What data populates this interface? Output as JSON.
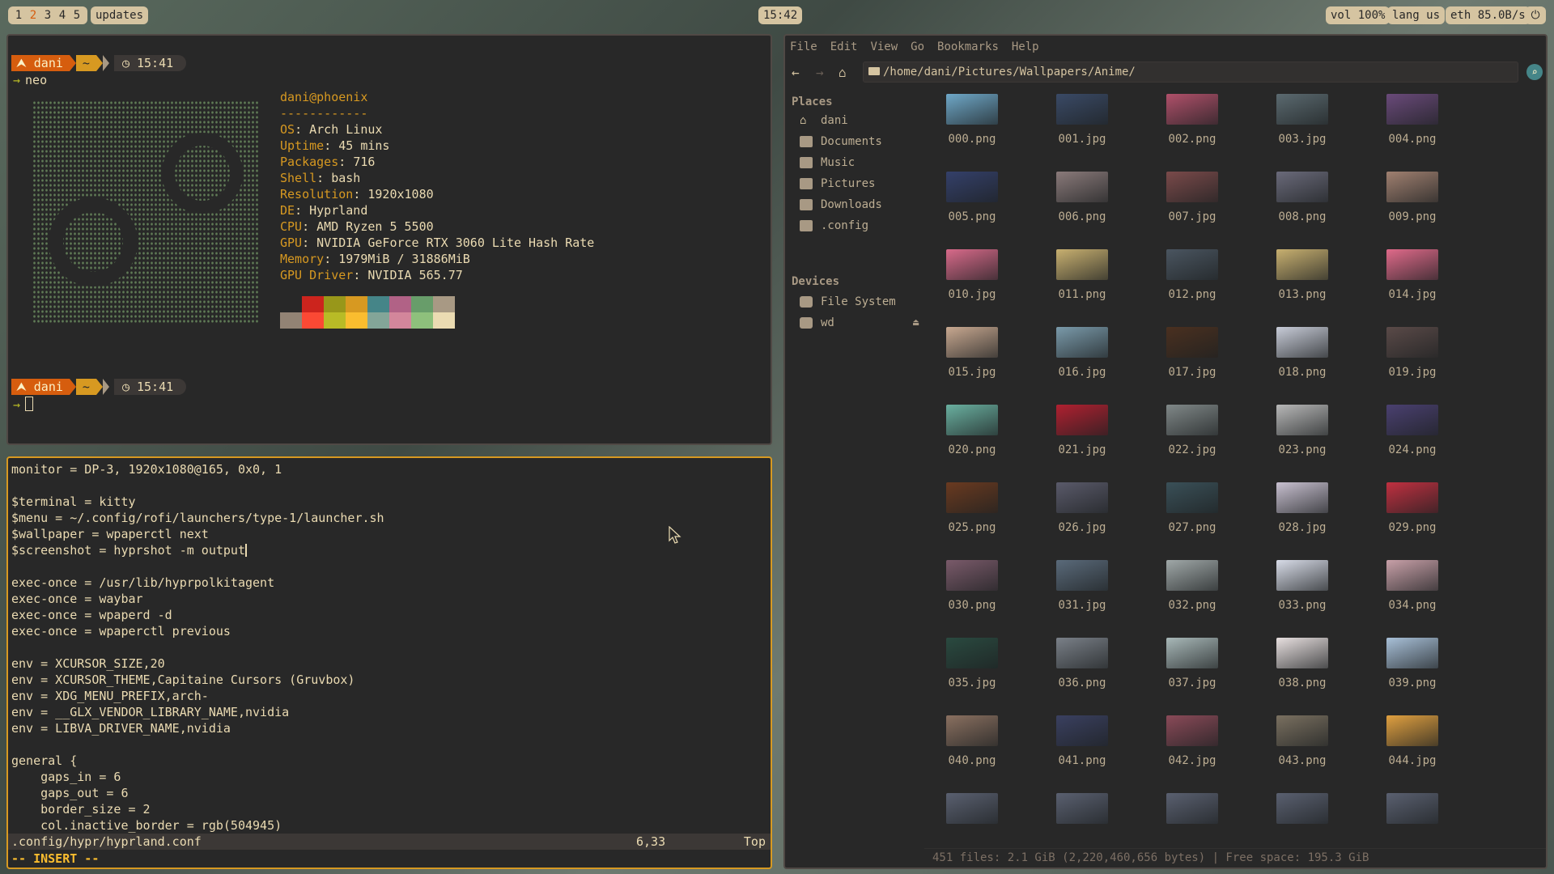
{
  "topbar": {
    "workspaces": [
      "1",
      "2",
      "3",
      "4",
      "5"
    ],
    "active_workspace": "2",
    "updates": "updates",
    "clock": "15:42",
    "volume": "vol 100%",
    "lang": "lang us",
    "net": "eth 85.0B/s",
    "power_icon": "power-icon"
  },
  "terminal": {
    "prompt1": {
      "user": "dani",
      "dir": "~",
      "time": "15:41"
    },
    "command": "neo",
    "neofetch": {
      "title": "dani@phoenix",
      "sep": "------------",
      "rows": [
        {
          "k": "OS",
          "v": "Arch Linux"
        },
        {
          "k": "Uptime",
          "v": "45 mins"
        },
        {
          "k": "Packages",
          "v": "716"
        },
        {
          "k": "Shell",
          "v": "bash"
        },
        {
          "k": "Resolution",
          "v": "1920x1080"
        },
        {
          "k": "DE",
          "v": "Hyprland"
        },
        {
          "k": "CPU",
          "v": "AMD Ryzen 5 5500"
        },
        {
          "k": "GPU",
          "v": "NVIDIA GeForce RTX 3060 Lite Hash Rate"
        },
        {
          "k": "Memory",
          "v": "1979MiB / 31886MiB"
        },
        {
          "k": "GPU Driver",
          "v": "NVIDIA 565.77"
        }
      ],
      "palette_top": [
        "#282828",
        "#cc241d",
        "#98971a",
        "#d79921",
        "#458588",
        "#b16286",
        "#689d6a",
        "#a89984"
      ],
      "palette_bottom": [
        "#928374",
        "#fb4934",
        "#b8bb26",
        "#fabd2f",
        "#83a598",
        "#d3869b",
        "#8ec07c",
        "#ebdbb2"
      ]
    },
    "prompt2": {
      "user": "dani",
      "dir": "~",
      "time": "15:41"
    }
  },
  "vim": {
    "lines": [
      "monitor = DP-3, 1920x1080@165, 0x0, 1",
      "",
      "$terminal = kitty",
      "$menu = ~/.config/rofi/launchers/type-1/launcher.sh",
      "$wallpaper = wpaperctl next",
      "$screenshot = hyprshot -m output",
      "",
      "exec-once = /usr/lib/hyprpolkitagent",
      "exec-once = waybar",
      "exec-once = wpaperd -d",
      "exec-once = wpaperctl previous",
      "",
      "env = XCURSOR_SIZE,20",
      "env = XCURSOR_THEME,Capitaine Cursors (Gruvbox)",
      "env = XDG_MENU_PREFIX,arch-",
      "env = __GLX_VENDOR_LIBRARY_NAME,nvidia",
      "env = LIBVA_DRIVER_NAME,nvidia",
      "",
      "general {",
      "    gaps_in = 6",
      "    gaps_out = 6",
      "    border_size = 2",
      "    col.inactive_border = rgb(504945)"
    ],
    "status_file": ".config/hypr/hyprland.conf",
    "status_pos": "6,33",
    "status_scroll": "Top",
    "mode": "-- INSERT --"
  },
  "filemanager": {
    "menu": [
      "File",
      "Edit",
      "View",
      "Go",
      "Bookmarks",
      "Help"
    ],
    "path": "/home/dani/Pictures/Wallpapers/Anime/",
    "places_header": "Places",
    "places": [
      "dani",
      "Documents",
      "Music",
      "Pictures",
      "Downloads",
      ".config"
    ],
    "devices_header": "Devices",
    "devices": [
      "File System",
      "wd"
    ],
    "files": [
      "000.png",
      "001.jpg",
      "002.png",
      "003.jpg",
      "004.png",
      "005.png",
      "006.png",
      "007.jpg",
      "008.png",
      "009.png",
      "010.jpg",
      "011.png",
      "012.png",
      "013.png",
      "014.jpg",
      "015.jpg",
      "016.jpg",
      "017.jpg",
      "018.png",
      "019.jpg",
      "020.png",
      "021.jpg",
      "022.jpg",
      "023.png",
      "024.png",
      "025.png",
      "026.jpg",
      "027.png",
      "028.jpg",
      "029.png",
      "030.png",
      "031.jpg",
      "032.png",
      "033.png",
      "034.png",
      "035.jpg",
      "036.png",
      "037.jpg",
      "038.png",
      "039.png",
      "040.png",
      "041.png",
      "042.jpg",
      "043.png",
      "044.jpg"
    ],
    "thumb_colors": [
      "#6fa8c8",
      "#3a4a66",
      "#b0506a",
      "#5b6a70",
      "#6a4a7a",
      "#34406a",
      "#8a7a7a",
      "#7a4a4a",
      "#6a6a7a",
      "#a08070",
      "#d86a8a",
      "#c8b070",
      "#4a5560",
      "#c8b070",
      "#e06a8a",
      "#c8a890",
      "#7a9aaa",
      "#4a3020",
      "#c8ccd8",
      "#5a4a48",
      "#6ab0a0",
      "#b02030",
      "#808888",
      "#b8b8b8",
      "#4a4070",
      "#6a3a20",
      "#5a5a6a",
      "#3a5058",
      "#c8c0d0",
      "#c03040",
      "#7a5a6a",
      "#5a6a7a",
      "#a0a8a8",
      "#d8dce8",
      "#c8a0a8",
      "#2a4a40",
      "#7a8088",
      "#a8b8b8",
      "#e8e0e0",
      "#a8c0d8",
      "#8a7060",
      "#3a4060",
      "#8a4a58",
      "#7a7060",
      "#e0a040"
    ],
    "status": "451 files: 2.1 GiB (2,220,460,656 bytes)  |  Free space: 195.3 GiB"
  }
}
